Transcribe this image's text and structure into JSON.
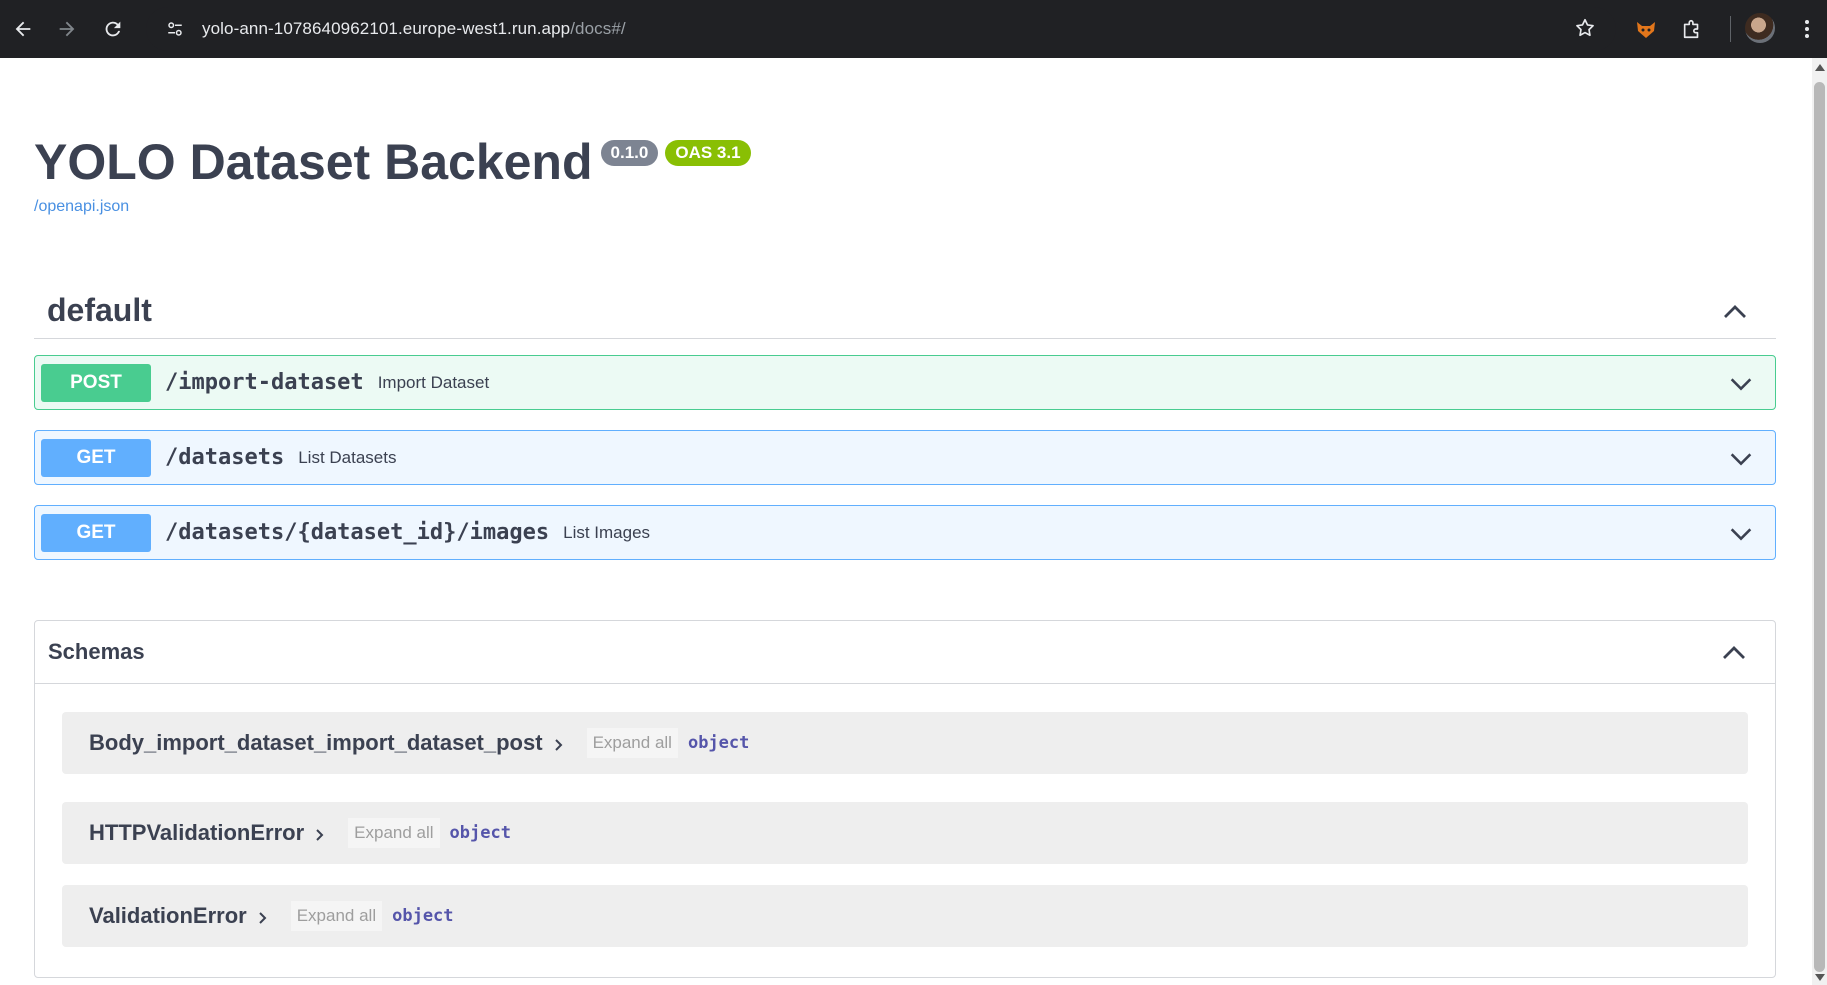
{
  "browser": {
    "url_host": "yolo-ann-1078640962101.europe-west1.run.app",
    "url_path": "/docs#/"
  },
  "info": {
    "title": "YOLO Dataset Backend",
    "version": "0.1.0",
    "oas": "OAS 3.1",
    "spec_link": "/openapi.json"
  },
  "section": {
    "title": "default"
  },
  "operations": [
    {
      "method": "POST",
      "path": "/import-dataset",
      "summary": "Import Dataset"
    },
    {
      "method": "GET",
      "path": "/datasets",
      "summary": "List Datasets"
    },
    {
      "method": "GET",
      "path": "/datasets/{dataset_id}/images",
      "summary": "List Images"
    }
  ],
  "schemas": {
    "title": "Schemas",
    "items": [
      {
        "name": "Body_import_dataset_import_dataset_post",
        "expand": "Expand all",
        "type": "object"
      },
      {
        "name": "HTTPValidationError",
        "expand": "Expand all",
        "type": "object"
      },
      {
        "name": "ValidationError",
        "expand": "Expand all",
        "type": "object"
      }
    ]
  },
  "colors": {
    "post": "#49cc90",
    "get": "#61affe",
    "oas_badge": "#89bf04",
    "version_badge": "#7d8492"
  }
}
